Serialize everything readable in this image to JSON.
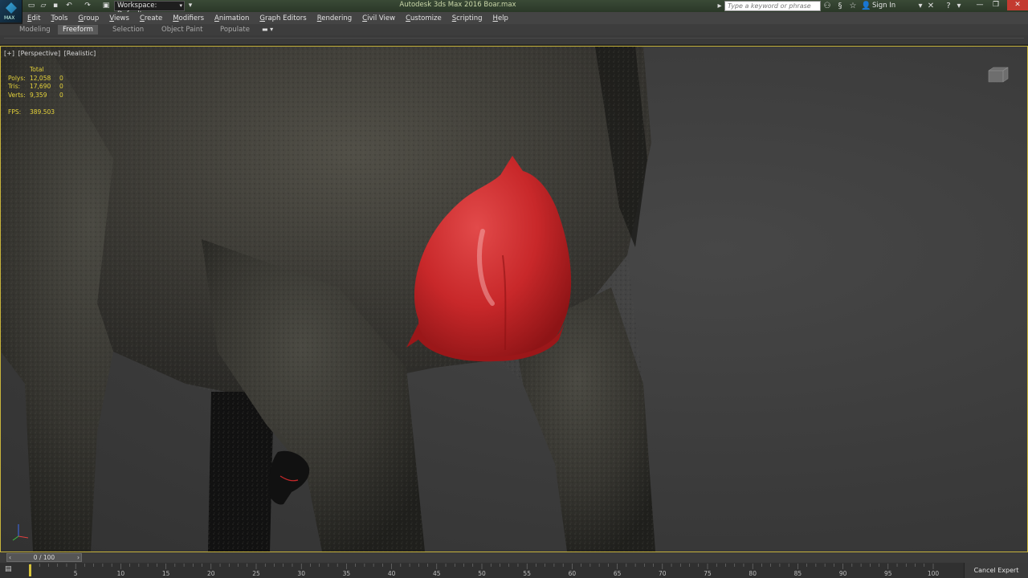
{
  "titlebar": {
    "logo_text": "MAX",
    "workspace_label": "Workspace: Default",
    "window_title": "Autodesk 3ds Max 2016    Boar.max",
    "search_placeholder": "Type a keyword or phrase",
    "sign_in": "Sign In"
  },
  "menubar": {
    "items": [
      "Edit",
      "Tools",
      "Group",
      "Views",
      "Create",
      "Modifiers",
      "Animation",
      "Graph Editors",
      "Rendering",
      "Civil View",
      "Customize",
      "Scripting",
      "Help"
    ]
  },
  "ribbon": {
    "tabs": [
      "Modeling",
      "Freeform",
      "Selection",
      "Object Paint",
      "Populate"
    ],
    "active_tab": "Freeform"
  },
  "viewport": {
    "labels": [
      "[+]",
      "[Perspective]",
      "[Realistic]"
    ],
    "stats": {
      "header": "Total",
      "rows": [
        {
          "label": "Polys:",
          "total": "12,058",
          "selected": "0"
        },
        {
          "label": "Tris:",
          "total": "17,690",
          "selected": "0"
        },
        {
          "label": "Verts:",
          "total": "9,359",
          "selected": "0"
        }
      ],
      "fps_label": "FPS:",
      "fps_value": "389.503"
    }
  },
  "timeline": {
    "current": "0 / 100",
    "ticks": [
      "5",
      "10",
      "15",
      "20",
      "25",
      "30",
      "35",
      "40",
      "45",
      "50",
      "55",
      "60",
      "65",
      "70",
      "75",
      "80",
      "85",
      "90",
      "95",
      "100"
    ],
    "cancel_expert_mode": "Cancel Expert Mode"
  },
  "colors": {
    "viewport_border": "#c8b43c",
    "stats_text": "#e6d33a",
    "selected_object": "#c8282a",
    "title_bar": "#2f3c2c"
  }
}
